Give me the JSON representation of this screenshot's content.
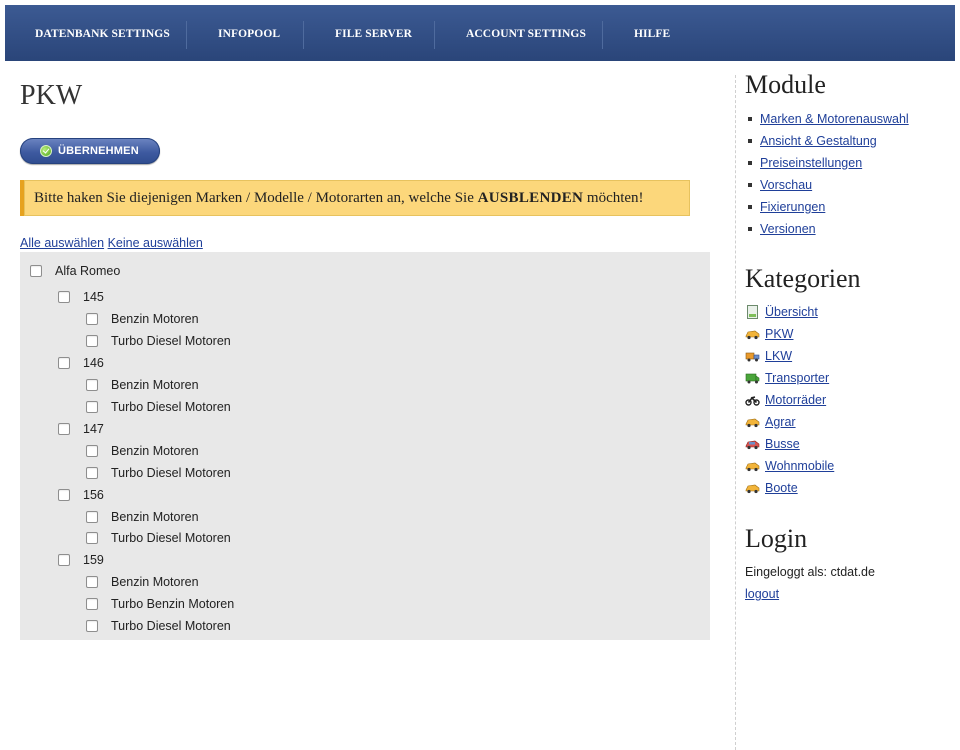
{
  "nav": {
    "items": [
      "DATENBANK SETTINGS",
      "INFOPOOL",
      "FILE SERVER",
      "ACCOUNT SETTINGS",
      "HILFE"
    ]
  },
  "main": {
    "title": "PKW",
    "apply_label": "ÜBERNEHMEN",
    "notice_pre": "Bitte haken Sie diejenigen Marken / Modelle / Motorarten an, welche Sie ",
    "notice_bold": "AUSBLENDEN",
    "notice_post": " möchten!",
    "select_all": "Alle auswählen",
    "select_none": "Keine auswählen",
    "tree": {
      "brand": "Alfa Romeo",
      "models": [
        {
          "name": "145",
          "engines": [
            "Benzin Motoren",
            "Turbo Diesel Motoren"
          ]
        },
        {
          "name": "146",
          "engines": [
            "Benzin Motoren",
            "Turbo Diesel Motoren"
          ]
        },
        {
          "name": "147",
          "engines": [
            "Benzin Motoren",
            "Turbo Diesel Motoren"
          ]
        },
        {
          "name": "156",
          "engines": [
            "Benzin Motoren",
            "Turbo Diesel Motoren"
          ]
        },
        {
          "name": "159",
          "engines": [
            "Benzin Motoren",
            "Turbo Benzin Motoren",
            "Turbo Diesel Motoren"
          ]
        }
      ]
    }
  },
  "sidebar": {
    "modules_title": "Module",
    "modules": [
      "Marken & Motorenauswahl",
      "Ansicht & Gestaltung",
      "Preiseinstellungen",
      "Vorschau",
      "Fixierungen",
      "Versionen"
    ],
    "categories_title": "Kategorien",
    "categories": [
      {
        "label": "Übersicht",
        "icon": "document-icon"
      },
      {
        "label": "PKW",
        "icon": "car-icon"
      },
      {
        "label": "LKW",
        "icon": "truck-icon"
      },
      {
        "label": "Transporter",
        "icon": "van-icon"
      },
      {
        "label": "Motorräder",
        "icon": "motorcycle-icon"
      },
      {
        "label": "Agrar",
        "icon": "tractor-icon"
      },
      {
        "label": "Busse",
        "icon": "bus-icon"
      },
      {
        "label": "Wohnmobile",
        "icon": "camper-icon"
      },
      {
        "label": "Boote",
        "icon": "boat-icon"
      }
    ],
    "login_title": "Login",
    "login_text": "Eingeloggt als: ctdat.de",
    "logout": "logout"
  },
  "colors": {
    "nav_bg": "#2e4a80",
    "notice_bg": "#fcd77b",
    "link": "#1f3f99",
    "tree_bg": "#e8e8e8"
  }
}
